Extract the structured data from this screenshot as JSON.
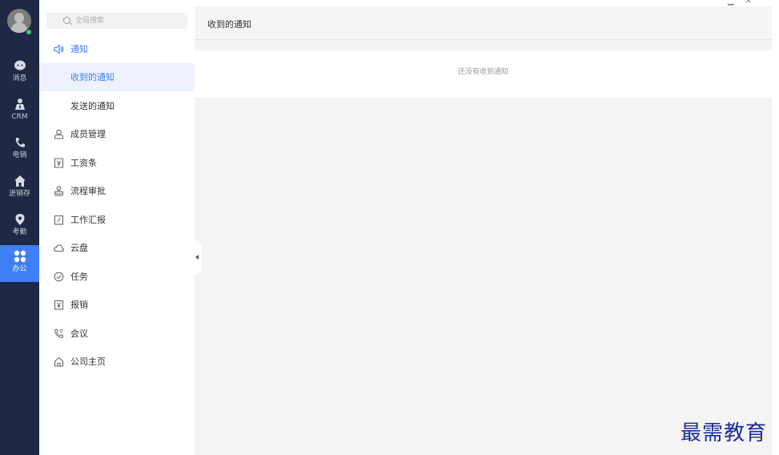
{
  "rail": {
    "items": [
      {
        "label": "消息",
        "icon": "chat-icon"
      },
      {
        "label": "CRM",
        "icon": "person-icon"
      },
      {
        "label": "电销",
        "icon": "phone-icon"
      },
      {
        "label": "进销存",
        "icon": "home-icon"
      },
      {
        "label": "考勤",
        "icon": "location-icon"
      },
      {
        "label": "办公",
        "icon": "grid-icon",
        "active": true
      }
    ]
  },
  "menu": {
    "search_placeholder": "全局搜索",
    "notice_label": "通知",
    "sub_items": [
      "收到的通知",
      "发送的通知"
    ],
    "items": [
      "成员管理",
      "工资条",
      "流程审批",
      "工作汇报",
      "云盘",
      "任务",
      "报销",
      "会议",
      "公司主页"
    ]
  },
  "main": {
    "title": "收到的通知",
    "empty_text": "还没有收到通知"
  },
  "watermark": "最需教育",
  "colors": {
    "rail": "#1f2844",
    "accent": "#3f7ef5",
    "online": "#2fcf6b"
  }
}
